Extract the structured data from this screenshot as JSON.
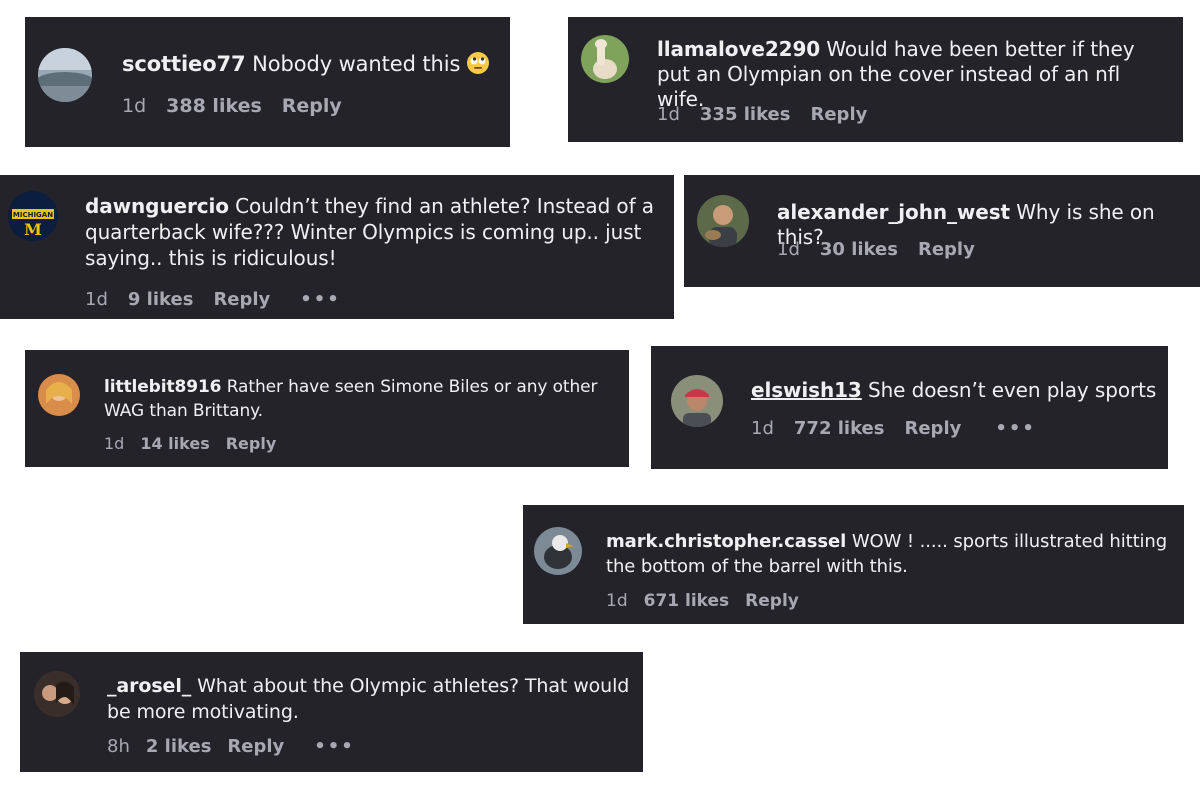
{
  "comments": [
    {
      "username": "scottieo77",
      "text": "Nobody wanted this",
      "emoji": "face-with-rolling-eyes",
      "time": "1d",
      "likes": "388 likes",
      "reply": "Reply",
      "more": ""
    },
    {
      "username": "llamalove2290",
      "text": "Would have been better if they put an Olympian on the cover instead of an nfl wife.",
      "time": "1d",
      "likes": "335 likes",
      "reply": "Reply",
      "more": ""
    },
    {
      "username": "dawnguercio",
      "text": "Couldn’t they find an athlete? Instead of a quarterback wife??? Winter Olympics is coming up.. just saying.. this is ridiculous!",
      "time": "1d",
      "likes": "9 likes",
      "reply": "Reply",
      "more": "•••"
    },
    {
      "username": "alexander_john_west",
      "text": "Why is she on this?",
      "time": "1d",
      "likes": "30 likes",
      "reply": "Reply",
      "more": ""
    },
    {
      "username": "littlebit8916",
      "text": "Rather have seen Simone Biles or any other WAG than Brittany.",
      "time": "1d",
      "likes": "14 likes",
      "reply": "Reply",
      "more": ""
    },
    {
      "username": "elswish13",
      "text": "She doesn’t even play sports",
      "time": "1d",
      "likes": "772 likes",
      "reply": "Reply",
      "more": "•••"
    },
    {
      "username": "mark.christopher.cassel",
      "text": "WOW ! ..... sports illustrated hitting the bottom of the barrel with this.",
      "time": "1d",
      "likes": "671 likes",
      "reply": "Reply",
      "more": ""
    },
    {
      "username": "_arosel_",
      "text": "What about the Olympic athletes? That would be more motivating.",
      "time": "8h",
      "likes": "2 likes",
      "reply": "Reply",
      "more": "•••"
    }
  ],
  "michigan_logo_text": "MICHIGAN",
  "colors": {
    "card_bg": "#232329",
    "text": "#f0f0f3",
    "meta": "#a8a8b3",
    "page_bg": "#ffffff"
  }
}
